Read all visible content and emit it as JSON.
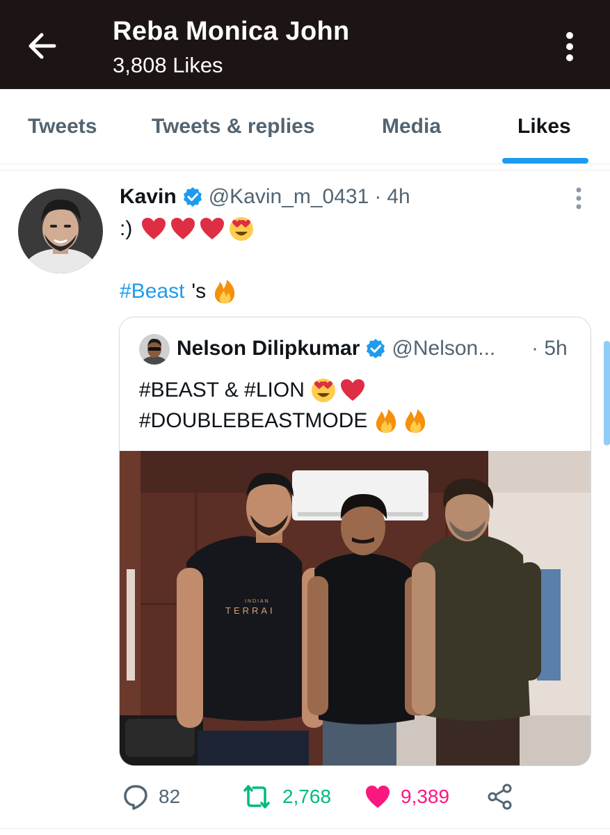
{
  "header": {
    "title": "Reba Monica John",
    "subtitle": "3,808 Likes",
    "bg_color": "#1d1514"
  },
  "tabs": [
    {
      "label": "Tweets",
      "active": false
    },
    {
      "label": "Tweets & replies",
      "active": false
    },
    {
      "label": "Media",
      "active": false
    },
    {
      "label": "Likes",
      "active": true
    }
  ],
  "tweet": {
    "name": "Kavin",
    "handle": "@Kavin_m_0431",
    "separator": "·",
    "time": "4h",
    "line1_text": ":)",
    "line1_emojis": [
      "red-heart",
      "red-heart",
      "red-heart",
      "heart-eyes"
    ],
    "hashtag": "#Beast",
    "hashtag_suffix": "'s",
    "line2_emoji": "fire",
    "quote": {
      "name": "Nelson Dilipkumar",
      "handle": "@Nelson...",
      "time": "· 5h",
      "line1_text": "#BEAST & #LION",
      "line1_emojis": [
        "heart-eyes",
        "red-heart"
      ],
      "line2_text": "#DOUBLEBEASTMODE",
      "line2_emojis": [
        "fire",
        "fire"
      ],
      "photo_tshirt_text": "TERRAI",
      "photo_tshirt_small": "INDIAN"
    },
    "actions": {
      "replies": "82",
      "retweets": "2,768",
      "likes": "9,389"
    }
  },
  "colors": {
    "accent": "#1d9bf0",
    "retweet_green": "#00ba7c",
    "like_pink": "#f91880",
    "text_secondary": "#536471"
  }
}
